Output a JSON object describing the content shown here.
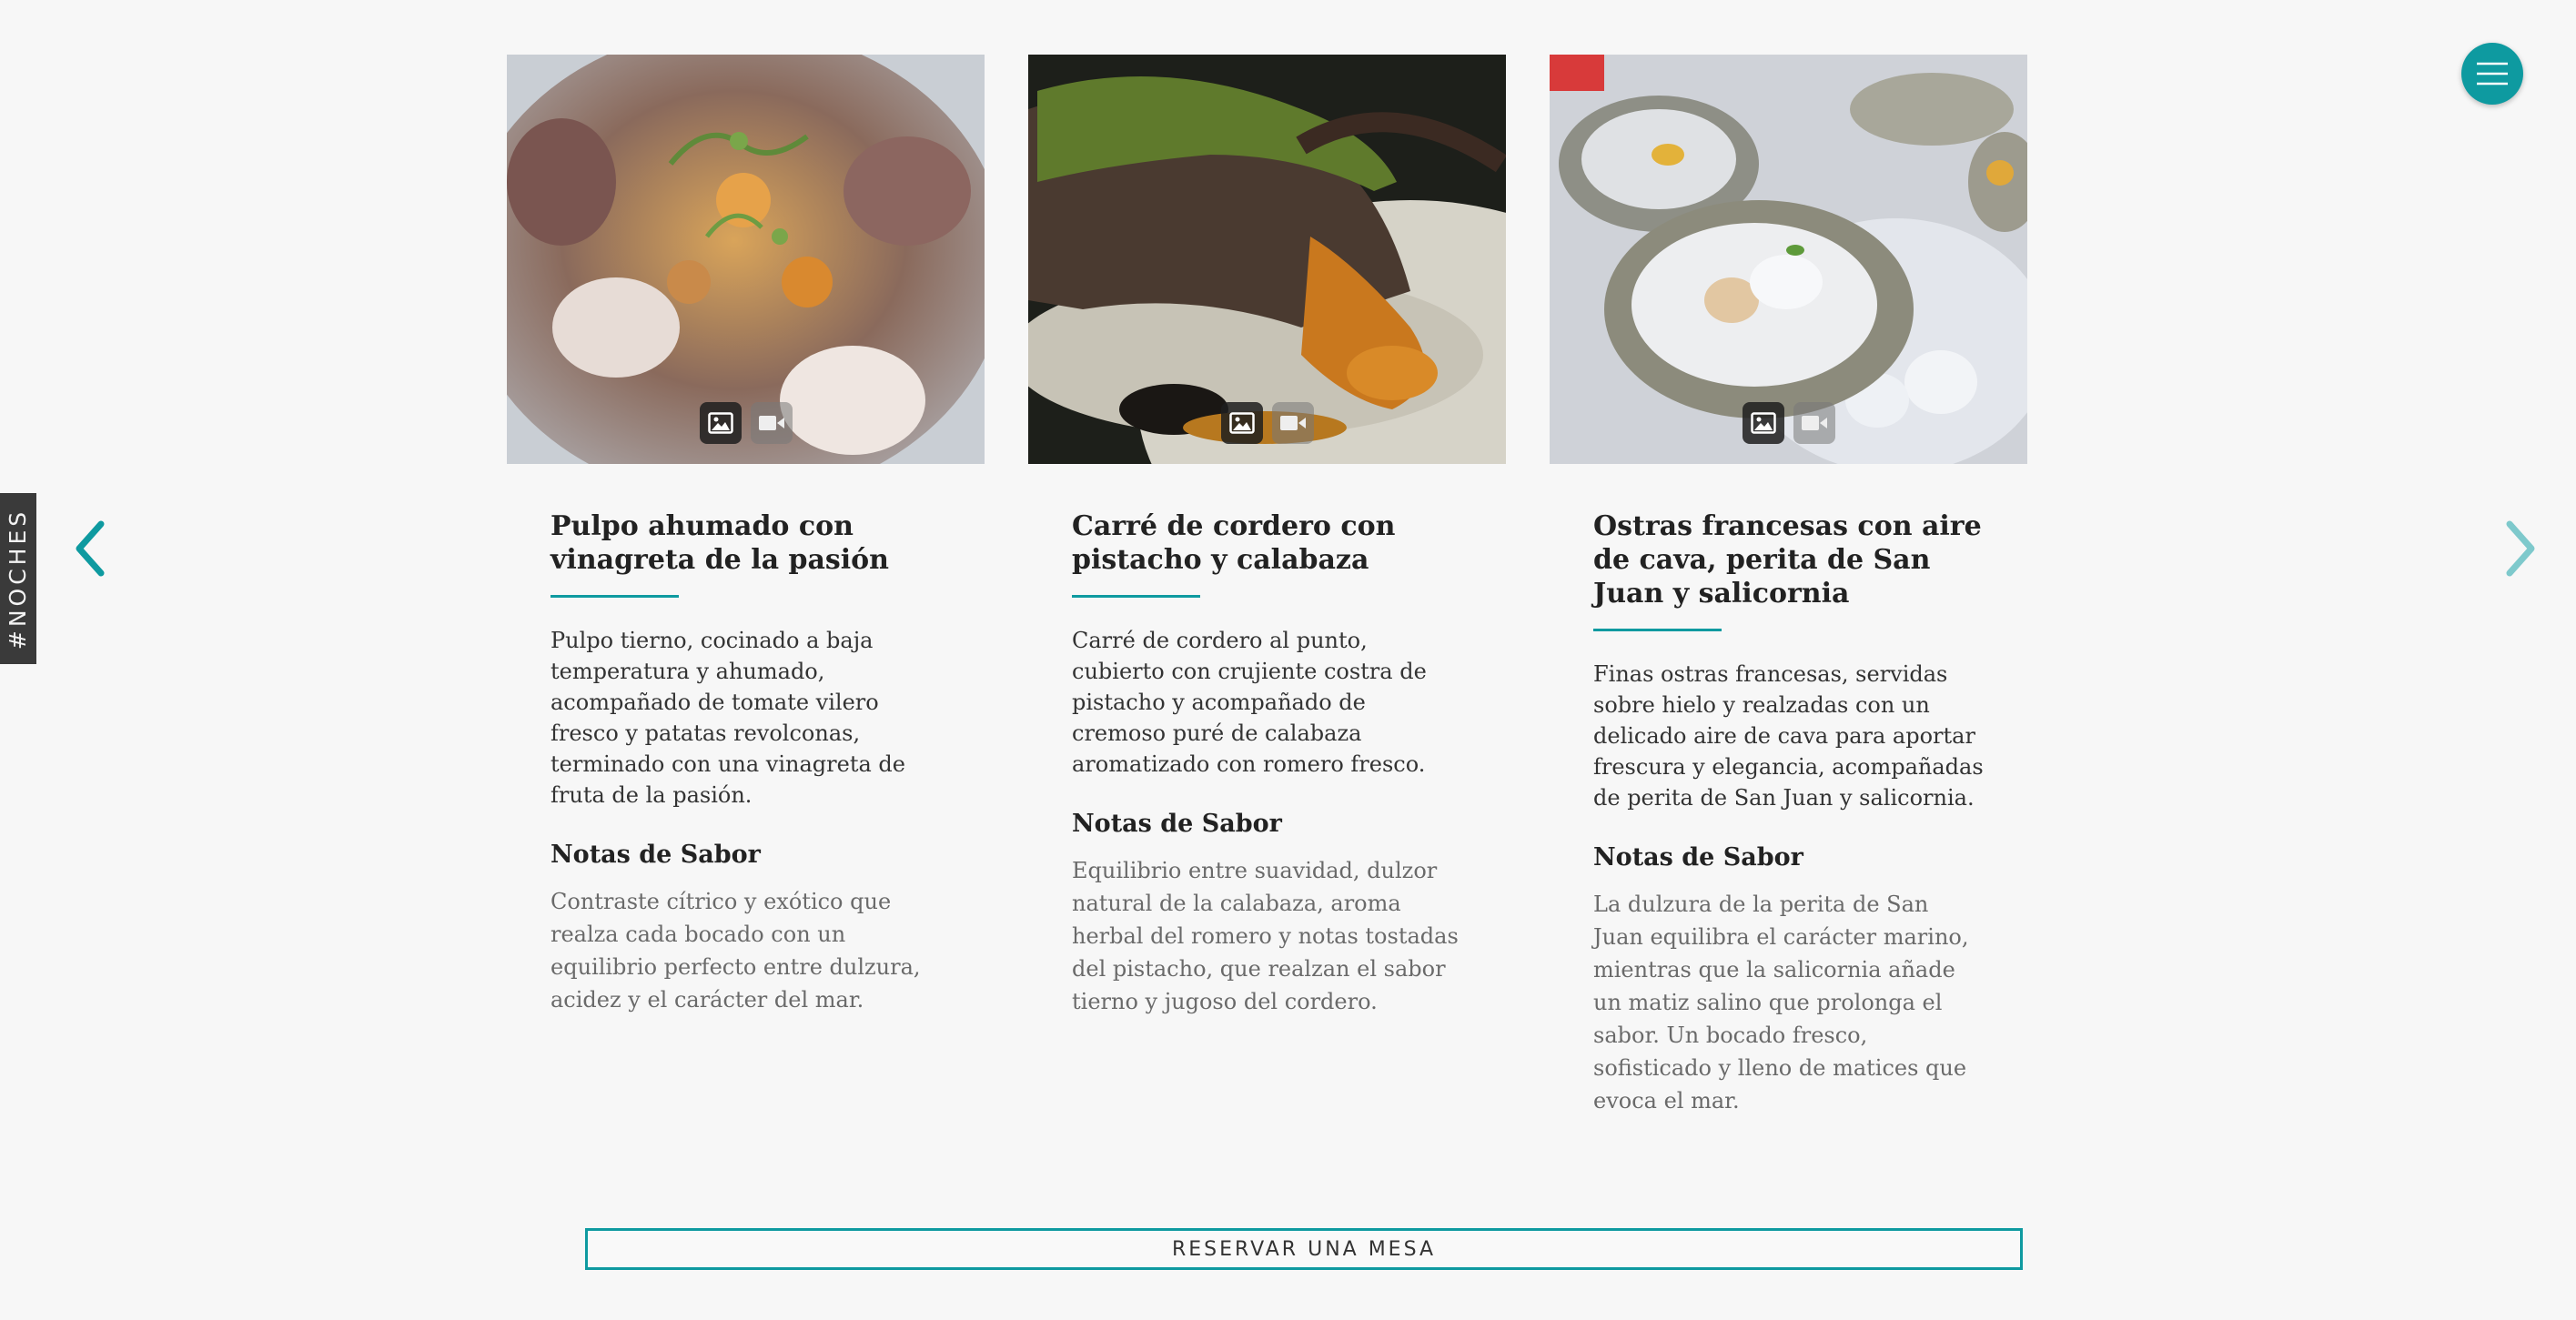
{
  "side_tab": {
    "label": "#NOCHES"
  },
  "colors": {
    "accent": "#0e9aa0",
    "side_tab_bg": "#3a3a3a",
    "background": "#f7f7f7"
  },
  "navigation": {
    "prev_icon": "chevron-left-icon",
    "next_icon": "chevron-right-icon",
    "menu_icon": "hamburger-menu-icon"
  },
  "media_toggle_icons": [
    "image-icon",
    "video-icon"
  ],
  "cards": [
    {
      "image": "photo of smoked octopus with herbs",
      "title": "Pulpo ahumado con vinagreta de la pasión",
      "description": "Pulpo tierno, cocinado a baja temperatura y ahumado, acompañado de tomate vilero fresco y patatas revolconas, terminado con una vinagreta de fruta de la pasión.",
      "notes_heading": "Notas de Sabor",
      "notes": "Contraste cítrico y exótico que realza cada bocado con un equilibrio perfecto entre dulzura, acidez y el carácter del mar."
    },
    {
      "image": "photo of lamb rack with pistachio crust",
      "title": "Carré de cordero con pistacho y calabaza",
      "description": "Carré de cordero al punto, cubierto con crujiente costra de pistacho y acompañado de cremoso puré de calabaza aromatizado con romero fresco.",
      "notes_heading": "Notas de Sabor",
      "notes": "Equilibrio entre suavidad, dulzor natural de la calabaza, aroma herbal del romero y notas tostadas del pistacho, que realzan el sabor tierno y jugoso del cordero."
    },
    {
      "image": "photo of french oysters on ice",
      "title": "Ostras francesas con aire de cava, perita de San Juan y salicornia",
      "description": "Finas ostras francesas, servidas sobre hielo y realzadas con un delicado aire de cava para aportar frescura y elegancia, acompañadas de perita de San Juan y salicornia.",
      "notes_heading": "Notas de Sabor",
      "notes": "La dulzura de la perita de San Juan equilibra el carácter marino, mientras que la salicornia añade un matiz salino que prolonga el sabor. Un bocado fresco, sofisticado y lleno de matices que evoca el mar."
    }
  ],
  "reserve_button": {
    "label": "RESERVAR UNA MESA"
  }
}
